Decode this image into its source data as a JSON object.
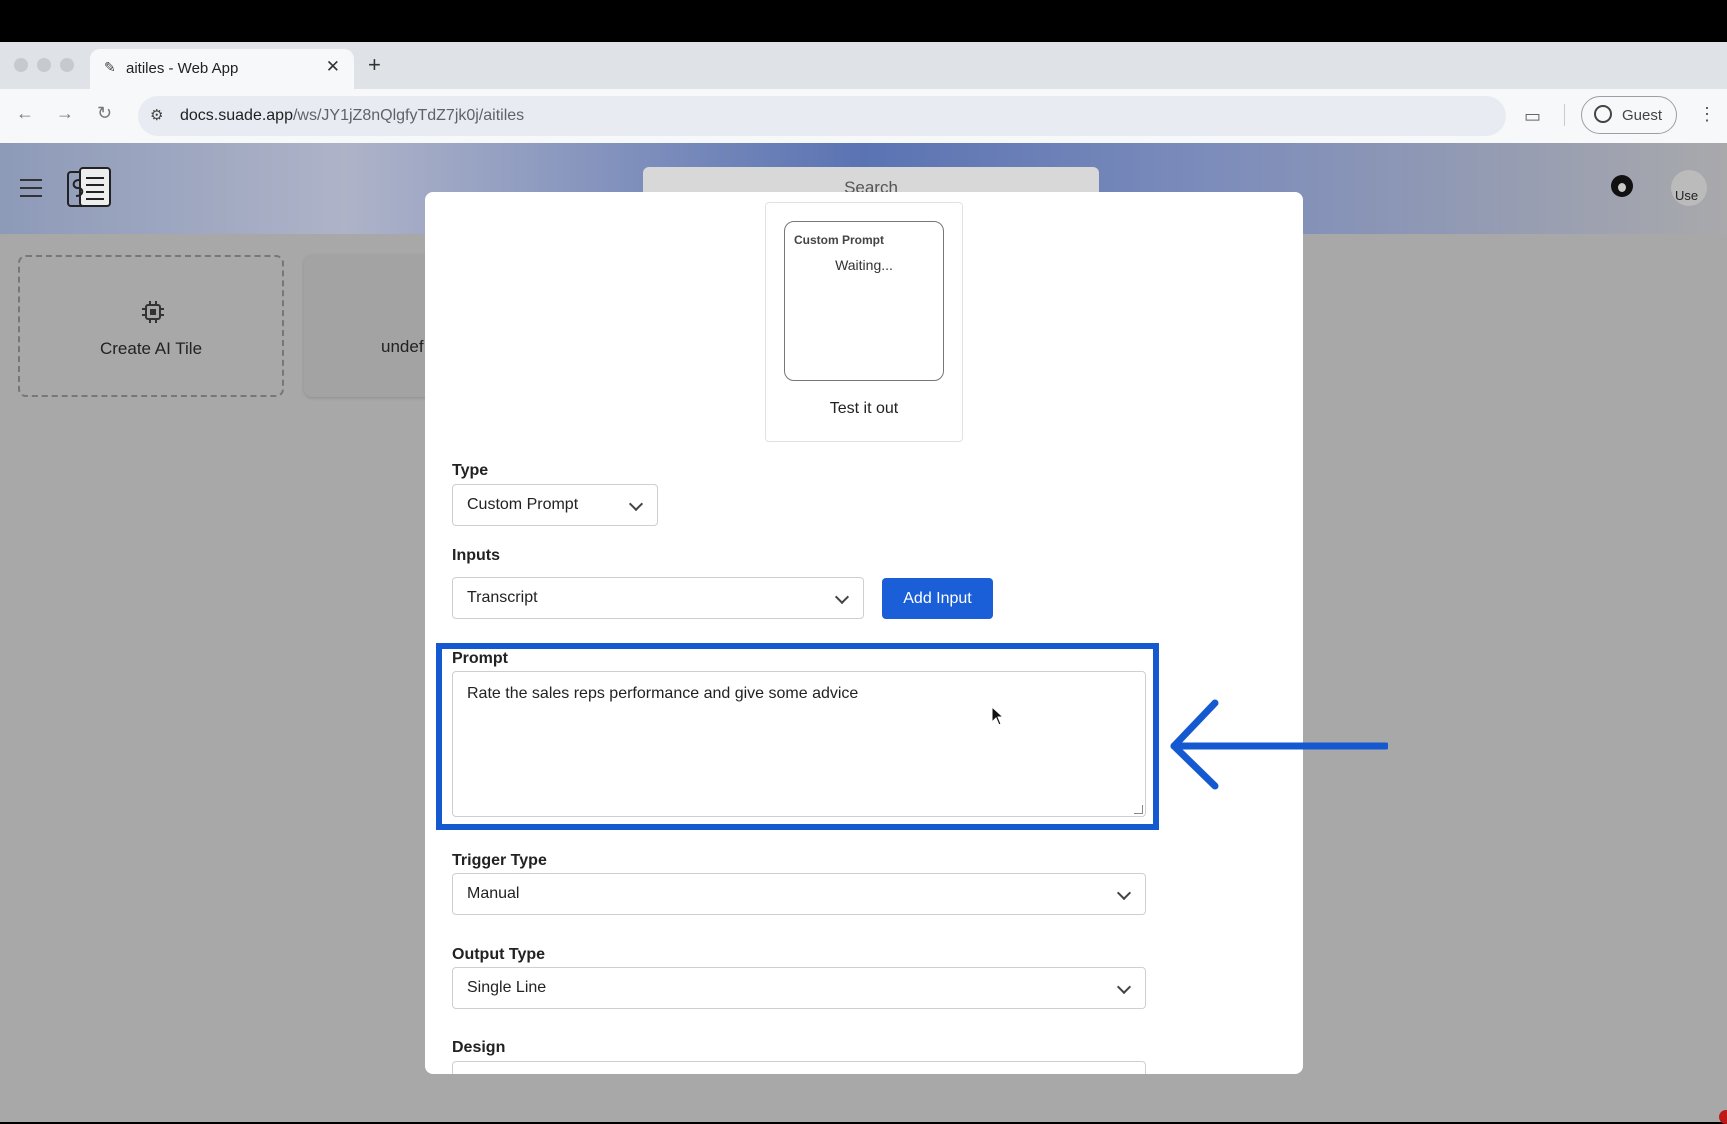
{
  "browser": {
    "tab_title": "aitiles - Web App",
    "tab_close": "✕",
    "new_tab": "+",
    "url_host": "docs.suade.app",
    "url_path": "/ws/JY1jZ8nQlgfyTdZ7jk0j/aitiles",
    "profile_label": "Guest",
    "nav": {
      "back": "←",
      "forward": "→",
      "reload": "↻",
      "menu": "⋮"
    }
  },
  "header": {
    "search_placeholder": "Search",
    "avatar_text": "Use"
  },
  "tiles": [
    {
      "label": "Create AI Tile",
      "icon": "chip-icon"
    },
    {
      "label": "undef"
    }
  ],
  "modal": {
    "preview": {
      "tile_title": "Custom Prompt",
      "tile_status": "Waiting...",
      "caption": "Test it out"
    },
    "type": {
      "label": "Type",
      "value": "Custom Prompt"
    },
    "inputs": {
      "label": "Inputs",
      "value": "Transcript",
      "add_button": "Add Input"
    },
    "prompt": {
      "label": "Prompt",
      "value": "Rate the sales reps performance and give some advice"
    },
    "trigger_type": {
      "label": "Trigger Type",
      "value": "Manual"
    },
    "output_type": {
      "label": "Output Type",
      "value": "Single Line"
    },
    "design": {
      "label": "Design"
    }
  },
  "annotation": {
    "color": "#1559d1",
    "arrow_direction": "left"
  }
}
